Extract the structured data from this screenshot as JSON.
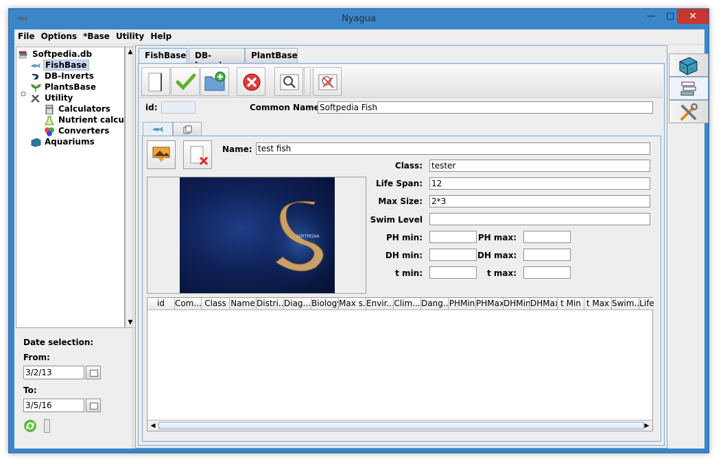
{
  "window": {
    "title": "Nyagua"
  },
  "menu": [
    "File",
    "Options",
    "*Base",
    "Utility",
    "Help"
  ],
  "tree": {
    "root": "Softpedia.db",
    "items": [
      {
        "label": "FishBase",
        "selected": true
      },
      {
        "label": "DB-Inverts"
      },
      {
        "label": "PlantsBase"
      },
      {
        "label": "Utility"
      },
      {
        "label": "Calculators"
      },
      {
        "label": "Nutrient calcul"
      },
      {
        "label": "Converters"
      },
      {
        "label": "Aquariums"
      }
    ]
  },
  "date_selection": {
    "title": "Date selection:",
    "from_label": "From:",
    "from_value": "3/2/13",
    "to_label": "To:",
    "to_value": "3/5/16"
  },
  "tabs": [
    "FishBase",
    "DB-Inverts",
    "PlantBase"
  ],
  "form": {
    "id_label": "id:",
    "id_value": "",
    "common_name_label": "Common Name:",
    "common_name_value": "Softpedia Fish",
    "name_label": "Name:",
    "name_value": "test fish",
    "class_label": "Class:",
    "class_value": "tester",
    "life_span_label": "Life Span:",
    "life_span_value": "12",
    "max_size_label": "Max Size:",
    "max_size_value": "2*3",
    "swim_level_label": "Swim Level",
    "swim_level_value": "",
    "ph_min_label": "PH min:",
    "ph_max_label": "PH max:",
    "dh_min_label": "DH min:",
    "dh_max_label": "DH max:",
    "t_min_label": "t min:",
    "t_max_label": "t max:"
  },
  "grid": {
    "columns": [
      "id",
      "Com...",
      "Class",
      "Name",
      "Distri...",
      "Diag...",
      "Biology",
      "Max s...",
      "Envir...",
      "Clim...",
      "Dang...",
      "PHMin",
      "PHMax",
      "DHMin",
      "DHMax",
      "t Min",
      "t Max",
      "Swim...",
      "Life"
    ]
  },
  "colors": {
    "title_bar": "#3a86c8",
    "close_button": "#c7372f",
    "selection": "#c9d8ee"
  }
}
